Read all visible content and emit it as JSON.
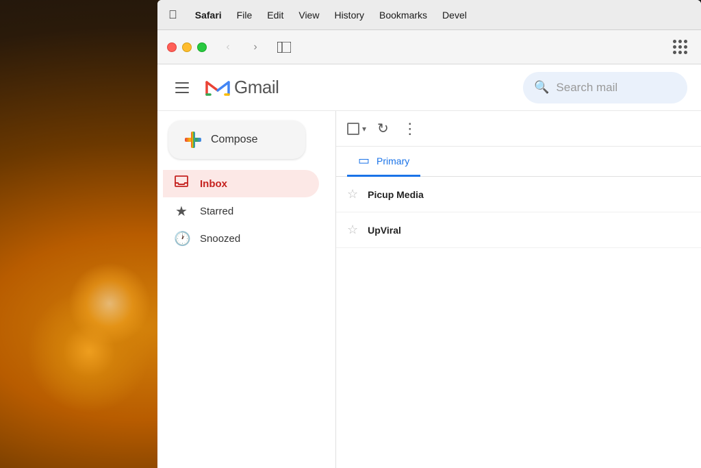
{
  "background": {
    "description": "warm bokeh fireplace background"
  },
  "menubar": {
    "apple": "&#63743;",
    "items": [
      {
        "id": "safari",
        "label": "Safari",
        "bold": true
      },
      {
        "id": "file",
        "label": "File"
      },
      {
        "id": "edit",
        "label": "Edit"
      },
      {
        "id": "view",
        "label": "View"
      },
      {
        "id": "history",
        "label": "History"
      },
      {
        "id": "bookmarks",
        "label": "Bookmarks"
      },
      {
        "id": "develop",
        "label": "Devel"
      }
    ]
  },
  "browser": {
    "back_arrow": "‹",
    "forward_arrow": "›",
    "sidebar_icon": "sidebar"
  },
  "gmail": {
    "logo_text": "Gmail",
    "search_placeholder": "Search mail",
    "compose_label": "Compose",
    "sidebar_items": [
      {
        "id": "inbox",
        "label": "Inbox",
        "active": true
      },
      {
        "id": "starred",
        "label": "Starred"
      },
      {
        "id": "snoozed",
        "label": "Snoozed"
      }
    ],
    "tabs": [
      {
        "id": "primary",
        "label": "Primary",
        "active": true
      }
    ],
    "email_rows": [
      {
        "id": "row1",
        "sender": "Picup Media"
      },
      {
        "id": "row2",
        "sender": "UpViral"
      }
    ]
  }
}
